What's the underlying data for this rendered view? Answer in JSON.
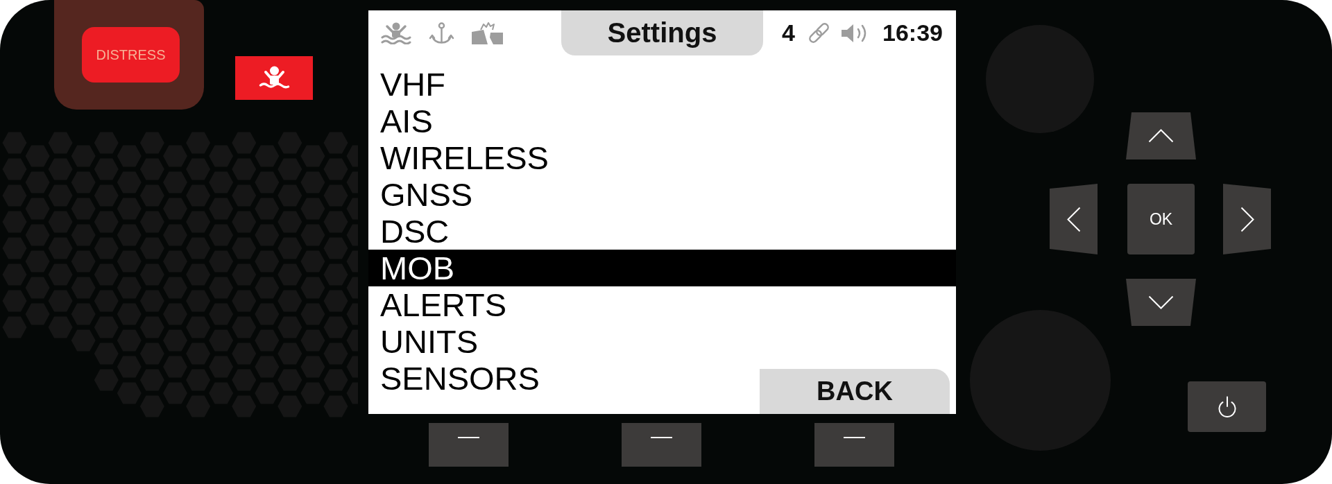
{
  "distress_button": {
    "label": "DISTRESS"
  },
  "screen": {
    "title": "Settings",
    "status_count": "4",
    "time": "16:39",
    "menu": [
      {
        "label": "VHF",
        "selected": false
      },
      {
        "label": "AIS",
        "selected": false
      },
      {
        "label": "WIRELESS",
        "selected": false
      },
      {
        "label": "GNSS",
        "selected": false
      },
      {
        "label": "DSC",
        "selected": false
      },
      {
        "label": "MOB",
        "selected": true
      },
      {
        "label": "ALERTS",
        "selected": false
      },
      {
        "label": "UNITS",
        "selected": false
      },
      {
        "label": "SENSORS",
        "selected": false
      }
    ],
    "back_button": {
      "label": "BACK"
    }
  },
  "keypad": {
    "ok_label": "OK"
  }
}
